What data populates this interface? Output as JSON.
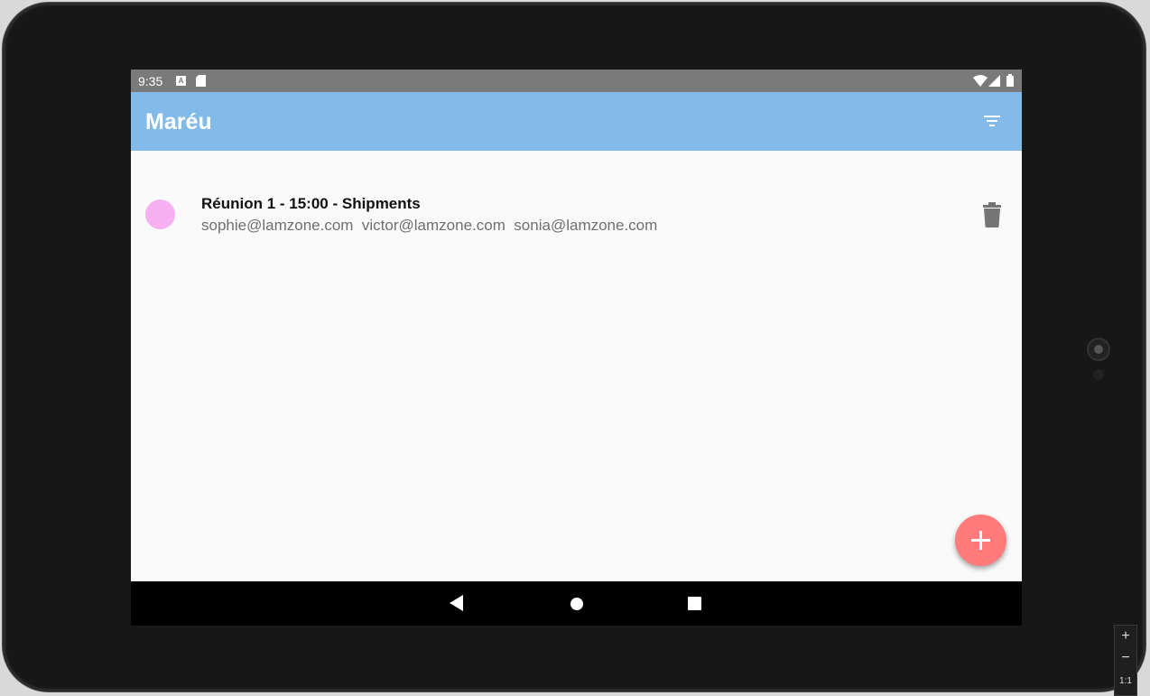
{
  "status_bar": {
    "time": "9:35",
    "notification_icon_letter": "A",
    "icons": [
      "a-notification-icon",
      "sd-card-icon",
      "wifi-icon",
      "signal-icon",
      "battery-icon"
    ]
  },
  "app_bar": {
    "title": "Maréu",
    "actions": [
      "filter-icon"
    ]
  },
  "meetings": [
    {
      "title": "Réunion 1 - 15:00 - Shipments",
      "participants": "sophie@lamzone.com  victor@lamzone.com  sonia@lamzone.com",
      "color": "#f7b1f3",
      "action_icon": "delete-icon"
    }
  ],
  "fab": {
    "icon": "plus-icon",
    "color": "#ff7b7b"
  },
  "nav_bar": {
    "icons": [
      "back-icon",
      "home-icon",
      "recents-icon"
    ]
  },
  "emulator_controls": {
    "zoom_in": "+",
    "zoom_out": "−",
    "ratio": "1:1"
  },
  "colors": {
    "app_bar": "#82bbea",
    "status_bar": "#7a7a7a",
    "background": "#fafafa"
  }
}
